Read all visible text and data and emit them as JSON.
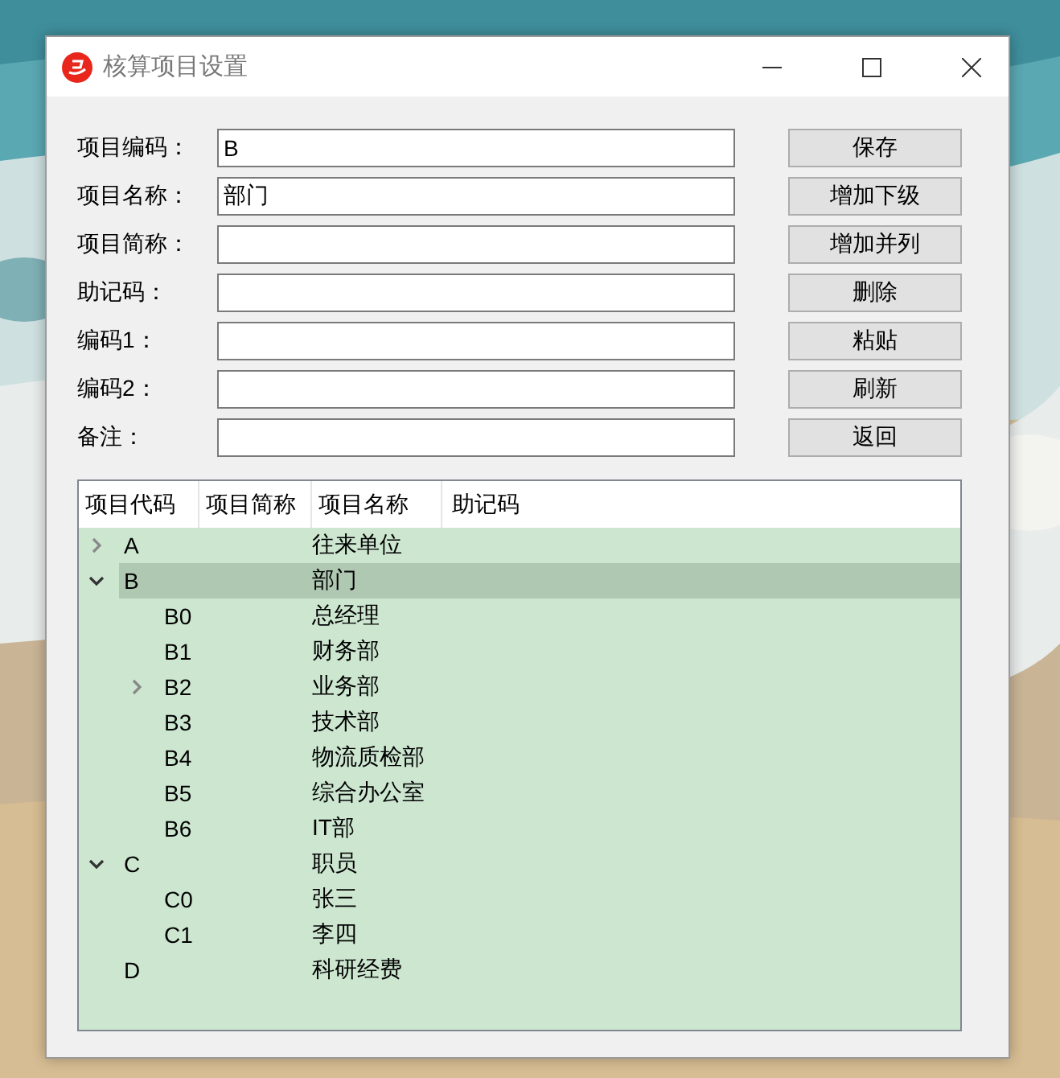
{
  "window": {
    "title": "核算项目设置"
  },
  "form": {
    "fields": [
      {
        "label": "项目编码：",
        "value": "B"
      },
      {
        "label": "项目名称：",
        "value": "部门"
      },
      {
        "label": "项目简称："
      },
      {
        "label": "助记码："
      },
      {
        "label": "编码1："
      },
      {
        "label": "编码2："
      },
      {
        "label": "备注："
      }
    ],
    "buttons": [
      "保存",
      "增加下级",
      "增加并列",
      "删除",
      "粘贴",
      "刷新",
      "返回"
    ]
  },
  "tree": {
    "columns": [
      "项目代码",
      "项目简称",
      "项目名称",
      "助记码"
    ],
    "items": [
      {
        "code": "A",
        "name": "往来单位",
        "expanded": false,
        "selected": false
      },
      {
        "code": "B",
        "name": "部门",
        "expanded": true,
        "selected": true,
        "children": [
          {
            "code": "B0",
            "name": "总经理",
            "selected": false
          },
          {
            "code": "B1",
            "name": "财务部",
            "selected": false
          },
          {
            "code": "B2",
            "name": "业务部",
            "expanded": false,
            "selected": false
          },
          {
            "code": "B3",
            "name": "技术部",
            "selected": false
          },
          {
            "code": "B4",
            "name": "物流质检部",
            "selected": false
          },
          {
            "code": "B5",
            "name": "综合办公室",
            "selected": false
          },
          {
            "code": "B6",
            "name": "IT部",
            "selected": false
          }
        ]
      },
      {
        "code": "C",
        "name": "职员",
        "expanded": true,
        "selected": false,
        "children": [
          {
            "code": "C0",
            "name": "张三",
            "selected": false
          },
          {
            "code": "C1",
            "name": "李四",
            "selected": false
          }
        ]
      },
      {
        "code": "D",
        "name": "科研经费",
        "selected": false
      }
    ]
  }
}
